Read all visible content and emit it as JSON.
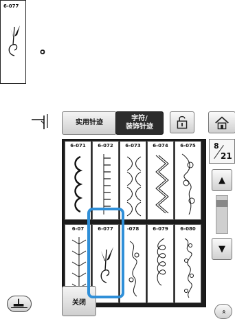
{
  "instruction": {
    "ref_code": "6-077",
    "trailing_mark": "。"
  },
  "tabs": {
    "utility": "实用针迹",
    "character": "字符/\n装饰针迹"
  },
  "icons": {
    "needle": "twin-needle-icon",
    "unlock": "unlock-icon",
    "home": "home-icon",
    "presser_foot": "presser-foot-icon",
    "more": "double-chevron-up-icon"
  },
  "patterns": [
    {
      "code": "6-071",
      "glyph": "scallop-curls"
    },
    {
      "code": "6-072",
      "glyph": "ladder"
    },
    {
      "code": "6-073",
      "glyph": "interlaced-leaves"
    },
    {
      "code": "6-074",
      "glyph": "zigzag-waves"
    },
    {
      "code": "6-075",
      "glyph": "floral-vine"
    },
    {
      "code": "6-07",
      "glyph": "feather-branches"
    },
    {
      "code": "6-077",
      "glyph": "leaf-swirl",
      "selected": true
    },
    {
      "code": "-078",
      "glyph": "twisted-tendril"
    },
    {
      "code": "6-079",
      "glyph": "loop-chain"
    },
    {
      "code": "6-080",
      "glyph": "scroll-vine"
    }
  ],
  "pagination": {
    "current": "8",
    "total": "21",
    "position_fraction": 0.12
  },
  "buttons": {
    "close": "关闭",
    "scroll_up": "▲",
    "scroll_down": "▼",
    "more": "»"
  },
  "colors": {
    "selection": "#2f8fd8",
    "active_tab": "#2c2c2c"
  }
}
